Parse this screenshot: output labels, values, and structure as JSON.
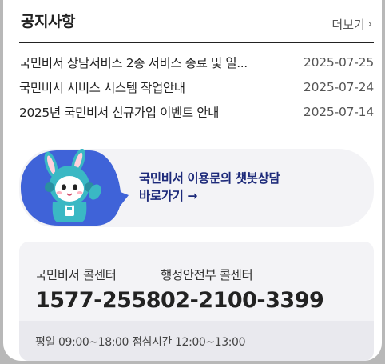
{
  "notice": {
    "title": "공지사항",
    "more_label": "더보기",
    "items": [
      {
        "title": "국민비서 상담서비스 2종 서비스 종료 및 일...",
        "date": "2025-07-25"
      },
      {
        "title": "국민비서 서비스 시스템 작업안내",
        "date": "2025-07-24"
      },
      {
        "title": "2025년 국민비서 신규가입 이벤트 안내",
        "date": "2025-07-14"
      }
    ]
  },
  "chatbot": {
    "line1": "국민비서 이용문의 챗봇상담",
    "line2": "바로가기 →",
    "bubble_color": "#3f63d8"
  },
  "callcenter": {
    "centers": [
      {
        "label": "국민비서 콜센터",
        "number": "1577-2558"
      },
      {
        "label": "행정안전부 콜센터",
        "number": "02-2100-3399"
      }
    ],
    "hours": "평일 09:00~18:00 점심시간 12:00~13:00"
  },
  "icons": {
    "more": "chevron-right-icon",
    "mascot": "rabbit-mascot-icon"
  }
}
